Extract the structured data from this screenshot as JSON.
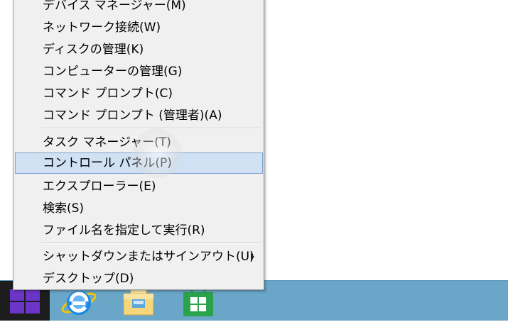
{
  "context_menu": {
    "items": [
      {
        "label": "デバイス マネージャー(M)"
      },
      {
        "label": "ネットワーク接続(W)"
      },
      {
        "label": "ディスクの管理(K)"
      },
      {
        "label": "コンピューターの管理(G)"
      },
      {
        "label": "コマンド プロンプト(C)"
      },
      {
        "label": "コマンド プロンプト (管理者)(A)"
      },
      {
        "label": "タスク マネージャー(T)"
      },
      {
        "label": "コントロール パネル(P)"
      },
      {
        "label": "エクスプローラー(E)"
      },
      {
        "label": "検索(S)"
      },
      {
        "label": "ファイル名を指定して実行(R)"
      },
      {
        "label": "シャットダウンまたはサインアウト(U)"
      },
      {
        "label": "デスクトップ(D)"
      }
    ],
    "highlighted_item": "コントロール パネル(P)"
  },
  "taskbar": {
    "background_color": "#6aa6c8",
    "start_button_color": "#1d1d1d",
    "start_logo_color": "#6b35c9",
    "apps": [
      {
        "icon": "internet-explorer-icon"
      },
      {
        "icon": "file-explorer-icon"
      },
      {
        "icon": "store-icon"
      }
    ]
  },
  "colors": {
    "menu_background": "#f0f0f0",
    "menu_highlight": "#cfe1f3",
    "menu_highlight_border": "#7da2ce"
  }
}
